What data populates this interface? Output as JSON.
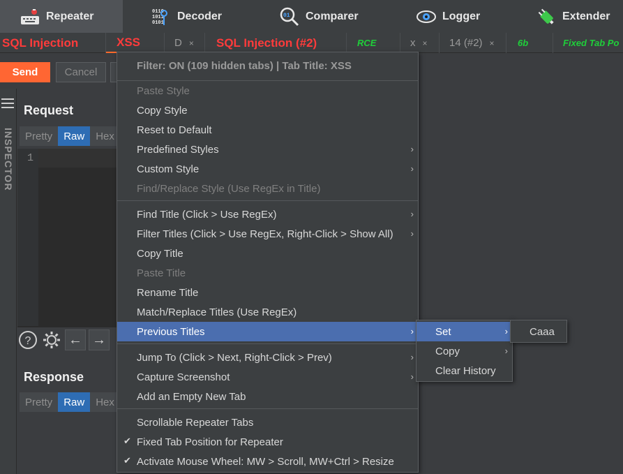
{
  "top_tabs": [
    {
      "label": "Repeater",
      "icon": "repeater-keyboard-icon",
      "active": true
    },
    {
      "label": "Decoder",
      "icon": "decoder-binary-icon",
      "active": false
    },
    {
      "label": "Comparer",
      "icon": "comparer-magnifier-icon",
      "active": false
    },
    {
      "label": "Logger",
      "icon": "logger-eye-icon",
      "active": false
    },
    {
      "label": "Extender",
      "icon": "extender-plug-icon",
      "active": false
    }
  ],
  "sub_tabs": [
    {
      "label": "SQL Injection",
      "style": "red",
      "close": ""
    },
    {
      "label": "XSS",
      "style": "red",
      "close": ""
    },
    {
      "label": "D",
      "style": "gray",
      "close": "×"
    },
    {
      "label": "SQL Injection (#2)",
      "style": "red",
      "close": ""
    },
    {
      "label": "RCE",
      "style": "green",
      "close": ""
    },
    {
      "label": "x",
      "style": "gray",
      "close": "×"
    },
    {
      "label": "14 (#2)",
      "style": "gray",
      "close": "×"
    },
    {
      "label": "6b",
      "style": "green",
      "close": ""
    },
    {
      "label": "Fixed Tab Po",
      "style": "green",
      "close": ""
    }
  ],
  "actions": {
    "send": "Send",
    "cancel": "Cancel"
  },
  "inspector": {
    "label": "INSPECTOR"
  },
  "request": {
    "title": "Request",
    "tabs": [
      "Pretty",
      "Raw",
      "Hex"
    ],
    "active_tab": "Raw",
    "line_number": "1"
  },
  "response": {
    "title": "Response",
    "tabs": [
      "Pretty",
      "Raw",
      "Hex"
    ],
    "active_tab": "Raw"
  },
  "bottom_tools": {
    "help": "?",
    "back": "←",
    "forward": "→"
  },
  "context_menu": {
    "header": "Filter: ON (109 hidden tabs) | Tab Title: XSS",
    "groups": [
      [
        {
          "label": "Paste Style",
          "disabled": true
        },
        {
          "label": "Copy Style"
        },
        {
          "label": "Reset to Default"
        },
        {
          "label": "Predefined Styles",
          "submenu": true
        },
        {
          "label": "Custom Style",
          "submenu": true
        },
        {
          "label": "Find/Replace Style (Use RegEx in Title)",
          "disabled": true
        }
      ],
      [
        {
          "label": "Find Title (Click > Use RegEx)",
          "submenu": true
        },
        {
          "label": "Filter Titles (Click > Use RegEx, Right-Click > Show All)",
          "submenu": true
        },
        {
          "label": "Copy Title"
        },
        {
          "label": "Paste Title",
          "disabled": true
        },
        {
          "label": "Rename Title"
        },
        {
          "label": "Match/Replace Titles (Use RegEx)"
        },
        {
          "label": "Previous Titles",
          "submenu": true,
          "highlighted": true
        }
      ],
      [
        {
          "label": "Jump To (Click > Next, Right-Click > Prev)",
          "submenu": true
        },
        {
          "label": "Capture Screenshot",
          "submenu": true
        },
        {
          "label": "Add an Empty New Tab"
        }
      ],
      [
        {
          "label": "Scrollable Repeater Tabs"
        },
        {
          "label": "Fixed Tab Position for Repeater",
          "checked": true
        },
        {
          "label": "Activate Mouse Wheel: MW > Scroll, MW+Ctrl > Resize",
          "checked": true
        }
      ]
    ]
  },
  "previous_titles_submenu": [
    {
      "label": "Set",
      "submenu": true,
      "highlighted": true
    },
    {
      "label": "Copy",
      "submenu": true
    },
    {
      "label": "Clear History"
    }
  ],
  "set_submenu": [
    {
      "label": "Caaa"
    }
  ],
  "colors": {
    "accent": "#ff6633",
    "highlight": "#4b6eaf",
    "tab_red": "#ff3b3b",
    "tab_green": "#1fcf3a",
    "raw_active": "#2e6db4"
  }
}
